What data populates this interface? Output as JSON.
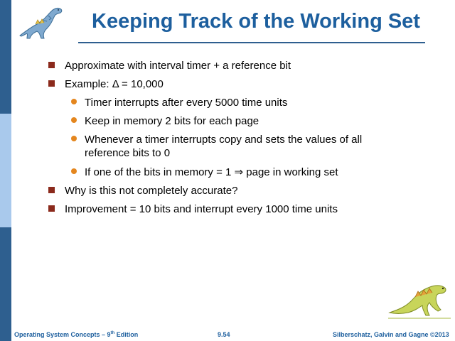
{
  "slide": {
    "title": "Keeping Track of the Working Set",
    "bullets": [
      {
        "level": 1,
        "text": "Approximate with interval timer + a reference bit"
      },
      {
        "level": 1,
        "text": "Example: Δ = 10,000"
      },
      {
        "level": 2,
        "text": "Timer interrupts after every 5000 time units"
      },
      {
        "level": 2,
        "text": "Keep in memory 2 bits for each page"
      },
      {
        "level": 2,
        "text": "Whenever a timer interrupts copy and sets the values of all",
        "text2": "reference bits to 0"
      },
      {
        "level": 2,
        "text": "If one of the bits in memory = 1 ⇒ page in working set"
      },
      {
        "level": 1,
        "text": "Why is this not completely accurate?"
      },
      {
        "level": 1,
        "text": "Improvement = 10 bits and interrupt every 1000 time units"
      }
    ]
  },
  "footer": {
    "left_prefix": "Operating System Concepts – 9",
    "left_sup": "th",
    "left_suffix": " Edition",
    "page_number": "9.54",
    "right": "Silberschatz, Galvin and Gagne ©2013"
  },
  "colors": {
    "title": "#1d5f9e",
    "sidebar_dark": "#2e5f8f",
    "sidebar_light": "#a9c9ec",
    "square_bullet": "#8b2a1c",
    "round_bullet": "#e4861e"
  },
  "icons": {
    "top_logo": "dinosaur-logo-icon",
    "bottom_logo": "dinosaur-logo-icon",
    "level1_bullet": "square-bullet-icon",
    "level2_bullet": "round-bullet-icon"
  }
}
